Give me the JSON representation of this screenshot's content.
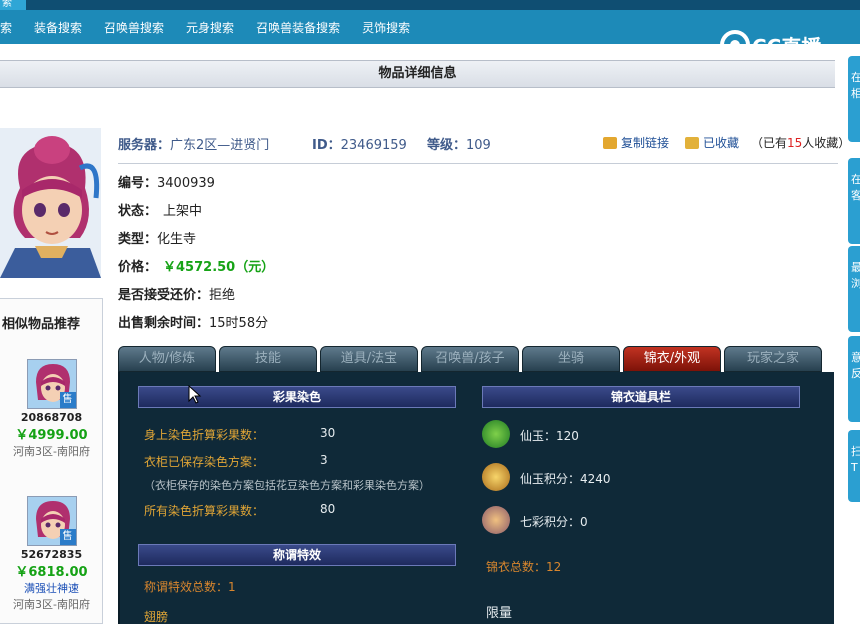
{
  "nav": {
    "top_fragment": "索",
    "links": [
      "索",
      "装备搜索",
      "召唤兽搜索",
      "元身搜索",
      "召唤兽装备搜索",
      "灵饰搜索"
    ]
  },
  "brand": {
    "logo_text": "CC直播"
  },
  "page_title": "物品详细信息",
  "item": {
    "server_label": "服务器：",
    "server": "广东2区—进贤门",
    "id_label": "ID：",
    "id": "23469159",
    "level_label": "等级：",
    "level": "109",
    "copy_link": "复制链接",
    "favorited": "已收藏",
    "fav_prefix": "（已有",
    "fav_count": "15",
    "fav_suffix": "人收藏）",
    "details": [
      {
        "key": "编号：",
        "value": "3400939"
      },
      {
        "key": "状态：",
        "value": "上架中"
      },
      {
        "key": "类型：",
        "value": "化生寺"
      },
      {
        "key": "价格：",
        "value": "￥4572.50（元）"
      },
      {
        "key": "是否接受还价：",
        "value": "拒绝"
      },
      {
        "key": "出售剩余时间：",
        "value": "15时58分"
      }
    ]
  },
  "similar": {
    "title": "相似物品推荐",
    "items": [
      {
        "id": "20868708",
        "price": "￥4999.00",
        "server": "河南3区-南阳府",
        "badge": "售"
      },
      {
        "id": "52672835",
        "price": "￥6818.00",
        "name": "满强壮神速",
        "server": "河南3区-南阳府",
        "badge": "售"
      }
    ]
  },
  "tabs": [
    "人物/修炼",
    "技能",
    "道具/法宝",
    "召唤兽/孩子",
    "坐骑",
    "锦衣/外观",
    "玩家之家"
  ],
  "active_tab": "锦衣/外观",
  "panel": {
    "dye": {
      "title": "彩果染色",
      "rows": [
        {
          "label": "身上染色折算彩果数：",
          "value": "30"
        },
        {
          "label": "衣柜已保存染色方案：",
          "value": "3"
        }
      ],
      "note": "（衣柜保存的染色方案包括花豆染色方案和彩果染色方案）",
      "total_label": "所有染色折算彩果数：",
      "total_value": "80"
    },
    "title_effects": {
      "title": "称谓特效",
      "count_text": "称谓特效总数：1",
      "first": "翅膀"
    },
    "costume_bar": {
      "title": "锦衣道具栏",
      "entries": [
        {
          "icon": "jade-coin-icon",
          "text": "仙玉：120"
        },
        {
          "icon": "jade-points-icon",
          "text": "仙玉积分：4240"
        },
        {
          "icon": "rainbow-points-icon",
          "text": "七彩积分：0"
        }
      ],
      "total": "锦衣总数：12",
      "limited": "限量"
    }
  },
  "right_toolbar": [
    "在\n相",
    "在\n客",
    "最\n浏",
    "意\n反",
    "扫\nT"
  ],
  "colors": {
    "nav_bg": "#1d8ab8",
    "price_green": "#16a316",
    "panel_bg": "#0f2938",
    "active_tab": "#c23322",
    "orange_text": "#e0a536"
  }
}
